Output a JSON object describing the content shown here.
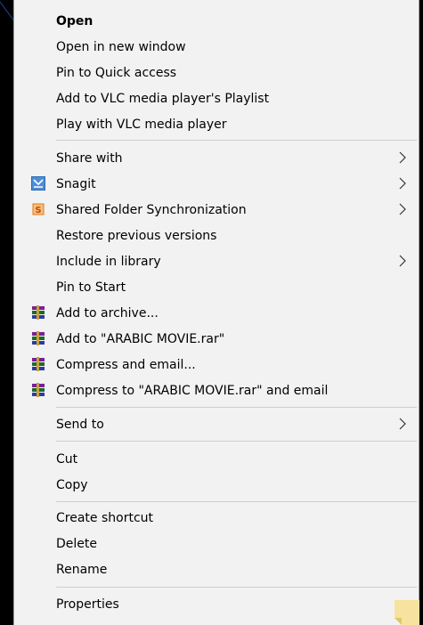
{
  "menu": {
    "items": [
      {
        "label": "Open",
        "bold": true
      },
      {
        "label": "Open in new window"
      },
      {
        "label": "Pin to Quick access"
      },
      {
        "label": "Add to VLC media player's Playlist"
      },
      {
        "label": "Play with VLC media player"
      },
      {
        "label": "Share with",
        "submenu": true
      },
      {
        "label": "Snagit",
        "icon": "snagit-icon",
        "submenu": true
      },
      {
        "label": "Shared Folder Synchronization",
        "icon": "shared-folder-sync-icon",
        "submenu": true
      },
      {
        "label": "Restore previous versions"
      },
      {
        "label": "Include in library",
        "submenu": true
      },
      {
        "label": "Pin to Start"
      },
      {
        "label": "Add to archive...",
        "icon": "winrar-icon"
      },
      {
        "label": "Add to \"ARABIC MOVIE.rar\"",
        "icon": "winrar-icon"
      },
      {
        "label": "Compress and email...",
        "icon": "winrar-icon"
      },
      {
        "label": "Compress to \"ARABIC MOVIE.rar\" and email",
        "icon": "winrar-icon"
      },
      {
        "label": "Send to",
        "submenu": true
      },
      {
        "label": "Cut"
      },
      {
        "label": "Copy"
      },
      {
        "label": "Create shortcut"
      },
      {
        "label": "Delete"
      },
      {
        "label": "Rename"
      },
      {
        "label": "Properties"
      }
    ]
  },
  "colors": {
    "menu_bg": "#f2f2f2",
    "separator": "#cfcfcf",
    "snagit_blue": "#2b6cb5",
    "sync_orange": "#e8731a"
  }
}
